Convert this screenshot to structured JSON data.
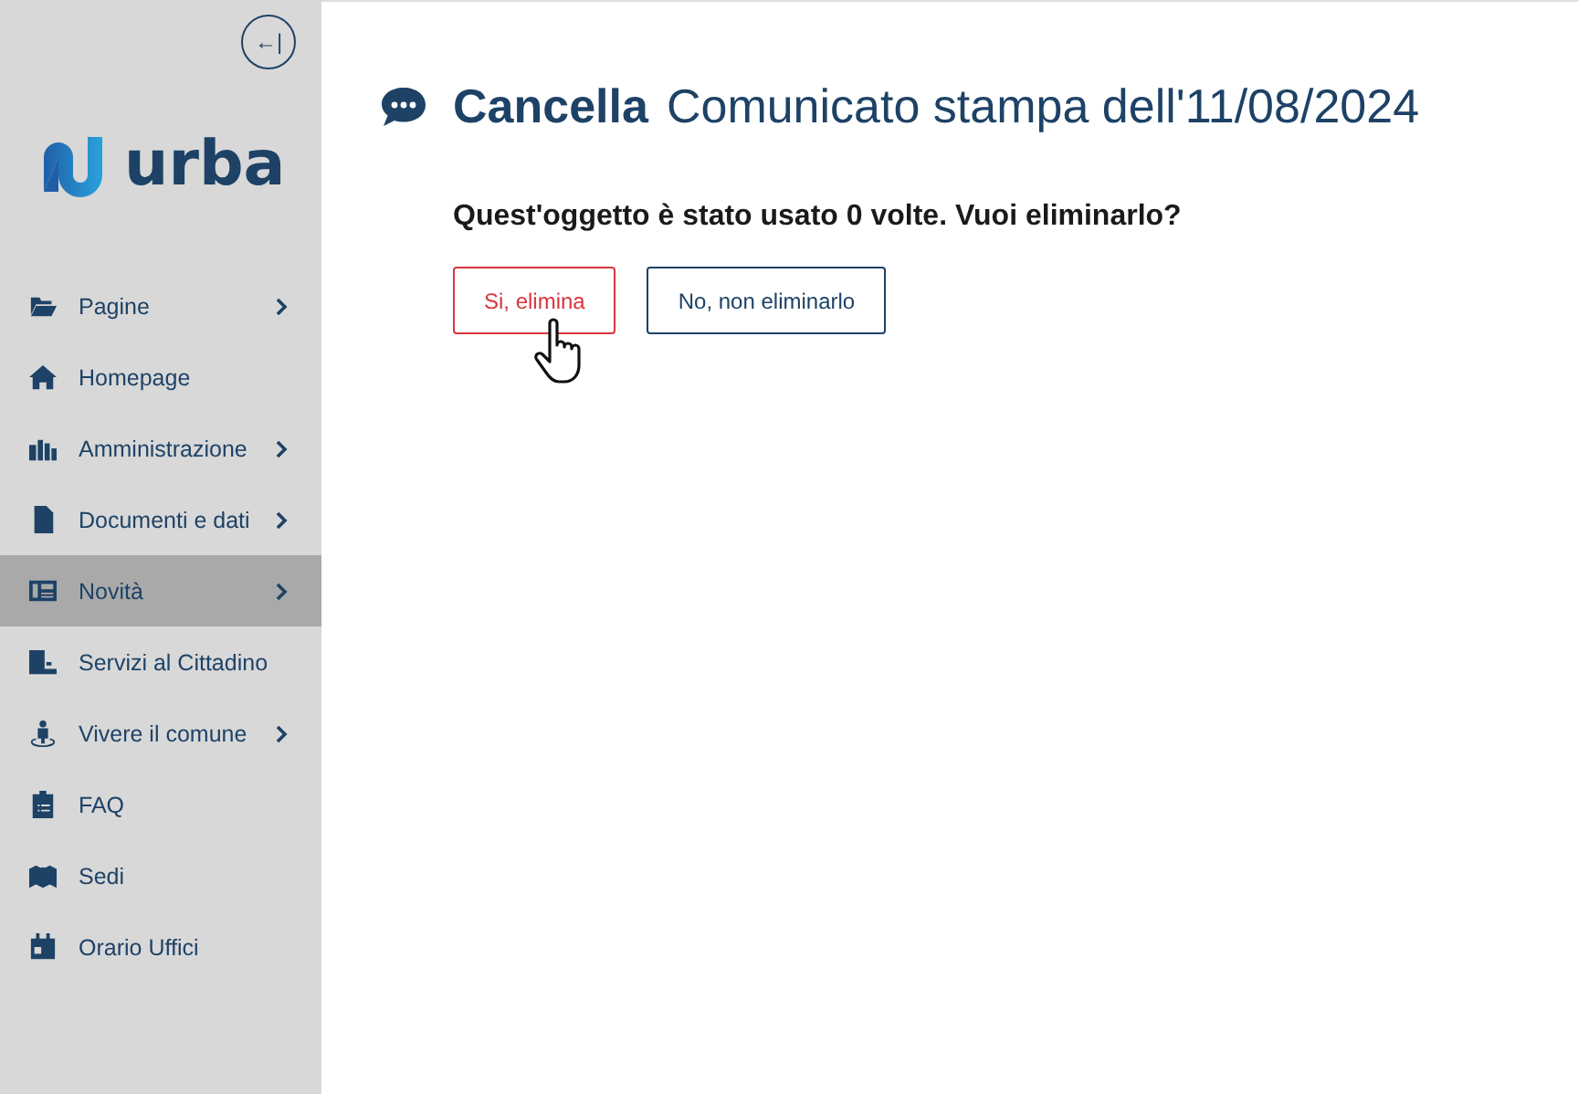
{
  "sidebar": {
    "collapse_button": "←|",
    "logo": "urba",
    "items": [
      {
        "label": "Pagine",
        "has_submenu": true,
        "selected": false
      },
      {
        "label": "Homepage",
        "has_submenu": false,
        "selected": false
      },
      {
        "label": "Amministrazione",
        "has_submenu": true,
        "selected": false
      },
      {
        "label": "Documenti e dati",
        "has_submenu": true,
        "selected": false
      },
      {
        "label": "Novità",
        "has_submenu": true,
        "selected": true
      },
      {
        "label": "Servizi al Cittadino",
        "has_submenu": false,
        "selected": false
      },
      {
        "label": "Vivere il comune",
        "has_submenu": true,
        "selected": false
      },
      {
        "label": "FAQ",
        "has_submenu": false,
        "selected": false
      },
      {
        "label": "Sedi",
        "has_submenu": false,
        "selected": false
      },
      {
        "label": "Orario Uffici",
        "has_submenu": false,
        "selected": false
      }
    ]
  },
  "main": {
    "action": "Cancella",
    "title": "Comunicato stampa dell'11/08/2024",
    "question": "Quest'oggetto è stato usato 0 volte. Vuoi eliminarlo?",
    "buttons": [
      {
        "label": "Si, elimina",
        "kind": "danger"
      },
      {
        "label": "No, non eliminarlo",
        "kind": "secondary"
      }
    ]
  }
}
